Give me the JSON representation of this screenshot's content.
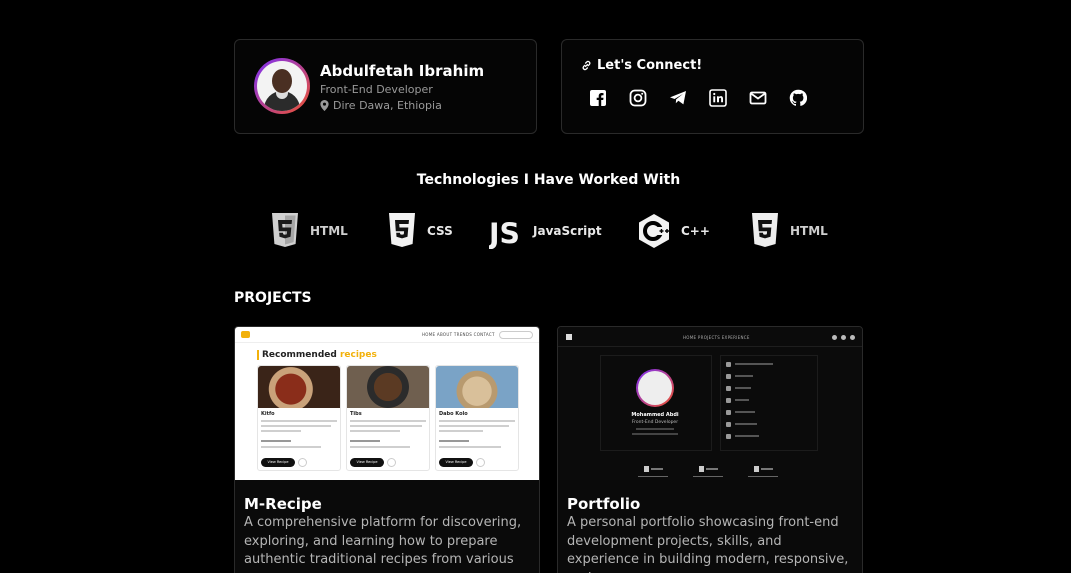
{
  "profile": {
    "name": "Abdulfetah Ibrahim",
    "role": "Front-End Developer",
    "location": "Dire Dawa, Ethiopia"
  },
  "connect": {
    "title": "Let's Connect!",
    "socials": [
      "facebook-icon",
      "instagram-icon",
      "telegram-icon",
      "linkedin-icon",
      "mail-icon",
      "github-icon"
    ]
  },
  "technologies": {
    "title": "Technologies I Have Worked With",
    "items": [
      {
        "label": "HTML",
        "icon": "html5-icon"
      },
      {
        "label": "CSS",
        "icon": "css3-icon"
      },
      {
        "label": "JavaScript",
        "icon": "js-icon"
      },
      {
        "label": "C++",
        "icon": "cpp-icon"
      },
      {
        "label": "HTML",
        "icon": "html5-icon"
      }
    ]
  },
  "projects": {
    "heading": "PROJECTS",
    "items": [
      {
        "title": "M-Recipe",
        "description": "A comprehensive platform for discovering, exploring, and learning how to prepare authentic traditional recipes from various",
        "preview": {
          "nav_links": "HOME   ABOUT   TRENDS   CONTACT",
          "heading": "Recommended",
          "heading_accent": "recipes",
          "recipes": [
            "Kitfo",
            "Tibs",
            "Dabo Kolo"
          ],
          "button": "View Recipe"
        }
      },
      {
        "title": "Portfolio",
        "description": "A personal portfolio showcasing front-end development projects, skills, and experience in building modern, responsive, and",
        "preview": {
          "nav_links": "HOME   PROJECTS   EXPERIENCE",
          "name": "Mohammed Abdi",
          "role": "Front-End Developer"
        }
      }
    ]
  },
  "colors": {
    "background": "#000000",
    "card_border": "#2a2a2a",
    "avatar_ring_start": "#7b2ff7",
    "avatar_ring_end": "#f0532d",
    "recipe_accent": "#f2b10b"
  }
}
